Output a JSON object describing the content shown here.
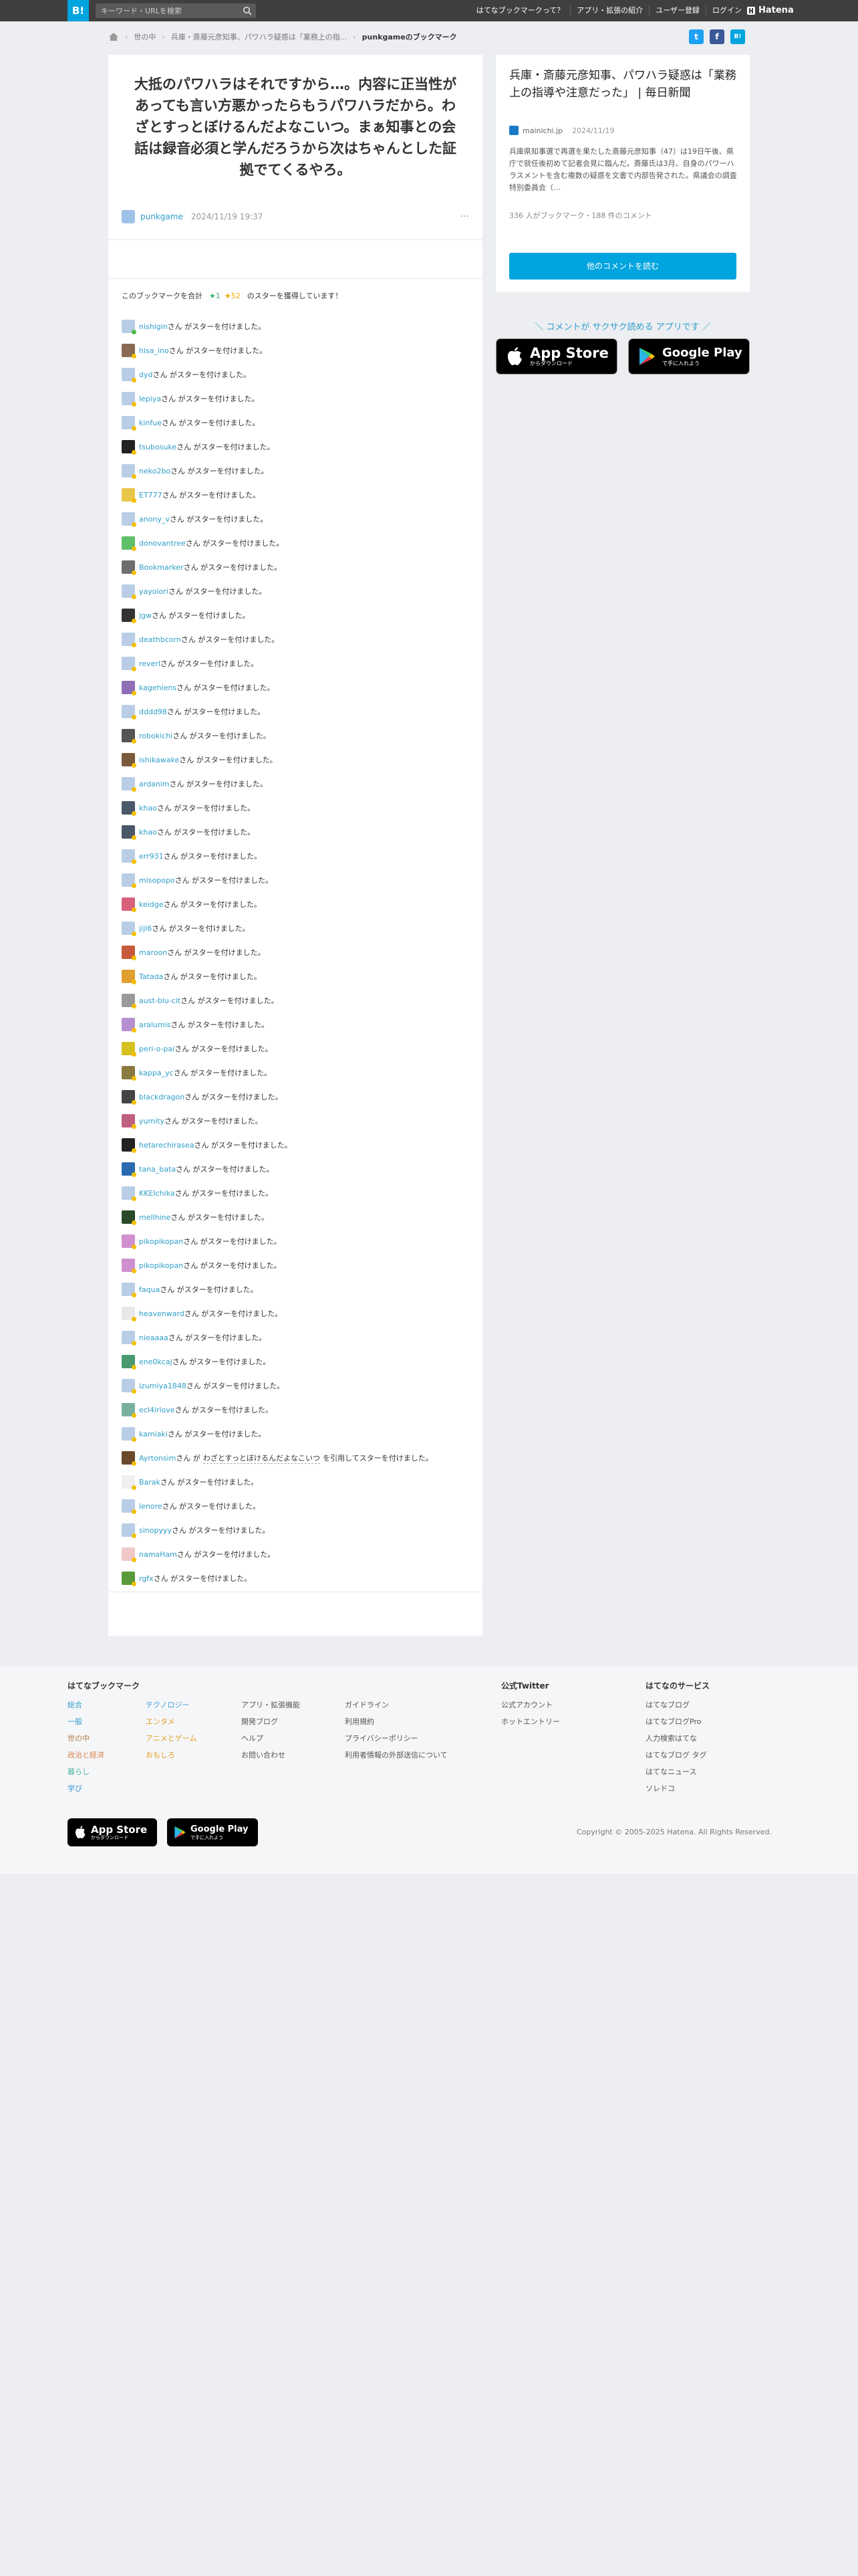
{
  "topbar": {
    "logo": "B!",
    "search_placeholder": "キーワード・URLを検索",
    "nav": [
      "はてなブックマークって？",
      "アプリ・拡張の紹介",
      "ユーザー登録",
      "ログイン"
    ],
    "brand": "Hatena"
  },
  "breadcrumb": {
    "items": [
      "世の中",
      "兵庫・斎藤元彦知事、パワハラ疑惑は「業務上の指...",
      "punkgameのブックマーク"
    ]
  },
  "share": [
    {
      "name": "twitter",
      "glyph": "t",
      "color": "#1da1f2"
    },
    {
      "name": "facebook",
      "glyph": "f",
      "color": "#3b5998"
    },
    {
      "name": "hatena",
      "glyph": "B!",
      "color": "#00a4de"
    }
  ],
  "comment": {
    "text": "大抵のパワハラはそれですから…。内容に正当性があっても言い方悪かったらもうパワハラだから。わざとすっとぼけるんだよなこいつ。まぁ知事との会話は録音必須と学んだろうから次はちゃんとした証拠でてくるやろ。",
    "user": "punkgame",
    "date": "2024/11/19 19:37",
    "more": "···"
  },
  "stars_summary": {
    "prefix": "このブックマークを合計",
    "green": "★1",
    "yellow": "★52",
    "suffix": "のスターを獲得しています！"
  },
  "star_suffix": "さん がスターを付けました。",
  "star_users": [
    {
      "user": "nishigin",
      "color": "#b9cde6"
    },
    {
      "user": "hisa_ino",
      "color": "#8a6a55"
    },
    {
      "user": "dyd",
      "color": "#b9cde6"
    },
    {
      "user": "lepiya",
      "color": "#b9cde6"
    },
    {
      "user": "kinfue",
      "color": "#b9cde6"
    },
    {
      "user": "tsubosuke",
      "color": "#222222"
    },
    {
      "user": "neko2bo",
      "color": "#b9cde6"
    },
    {
      "user": "ET777",
      "color": "#e8c64a"
    },
    {
      "user": "anony_v",
      "color": "#b9cde6"
    },
    {
      "user": "donovantree",
      "color": "#5fc06a"
    },
    {
      "user": "Bookmarker",
      "color": "#6e6e6e"
    },
    {
      "user": "yayoiori",
      "color": "#b9cde6"
    },
    {
      "user": "jgw",
      "color": "#333333"
    },
    {
      "user": "deathbcorn",
      "color": "#b9cde6"
    },
    {
      "user": "reverl",
      "color": "#b9cde6"
    },
    {
      "user": "kagehiens",
      "color": "#8e6fb5"
    },
    {
      "user": "dddd98",
      "color": "#b9cde6"
    },
    {
      "user": "robokichi",
      "color": "#555555"
    },
    {
      "user": "ishikawake",
      "color": "#7a5a3a"
    },
    {
      "user": "ardanim",
      "color": "#b9cde6"
    },
    {
      "user": "khao",
      "color": "#4a5868"
    },
    {
      "user": "khao",
      "color": "#4a5868"
    },
    {
      "user": "err931",
      "color": "#b9cde6"
    },
    {
      "user": "misopopo",
      "color": "#b9cde6"
    },
    {
      "user": "keidge",
      "color": "#d8607a"
    },
    {
      "user": "jiji6",
      "color": "#b9cde6"
    },
    {
      "user": "maroon",
      "color": "#c65a3a"
    },
    {
      "user": "Tatada",
      "color": "#e0a030"
    },
    {
      "user": "aust-blu-cit",
      "color": "#9a9a9a"
    },
    {
      "user": "aralumis",
      "color": "#b58fd0"
    },
    {
      "user": "peri-o-pai",
      "color": "#d6c020"
    },
    {
      "user": "kappa_yc",
      "color": "#8a7a40"
    },
    {
      "user": "blackdragon",
      "color": "#444444"
    },
    {
      "user": "yumity",
      "color": "#c06080"
    },
    {
      "user": "hetarechirasea",
      "color": "#222222"
    },
    {
      "user": "tana_bata",
      "color": "#2a6ab0"
    },
    {
      "user": "KKEIchika",
      "color": "#b9cde6"
    },
    {
      "user": "mellhine",
      "color": "#2a4a2a"
    },
    {
      "user": "pikopikopan",
      "color": "#d090d0"
    },
    {
      "user": "pikopikopan",
      "color": "#d090d0"
    },
    {
      "user": "faqua",
      "color": "#b9cde6"
    },
    {
      "user": "heavenward",
      "color": "#e8e8e8"
    },
    {
      "user": "nieaaaa",
      "color": "#b9cde6"
    },
    {
      "user": "ene0kcaj",
      "color": "#4a9a70"
    },
    {
      "user": "izumiya1848",
      "color": "#b9cde6"
    },
    {
      "user": "ecl4irlove",
      "color": "#7ab0a0"
    },
    {
      "user": "kamiaki",
      "color": "#b9cde6"
    },
    {
      "user": "Ayrtonsim",
      "color": "#6a4a2a",
      "quote": "わざとすっとぼけるんだよなこいつ",
      "suffix": "を引用してスターを付けました。"
    },
    {
      "user": "Barak",
      "color": "#f0f0f0"
    },
    {
      "user": "lenore",
      "color": "#b9cde6"
    },
    {
      "user": "sinopyyy",
      "color": "#b9cde6"
    },
    {
      "user": "namaHam",
      "color": "#f0c8c8"
    },
    {
      "user": "rgfx",
      "color": "#5a9a3a"
    }
  ],
  "entry": {
    "title": "兵庫・斎藤元彦知事、パワハラ疑惑は「業務上の指導や注意だった」 | 毎日新聞",
    "site": "mainichi.jp",
    "date": "2024/11/19",
    "description": "兵庫県知事選で再選を果たした斎藤元彦知事（47）は19日午後、県庁で就任後初めて記者会見に臨んだ。斎藤氏は3月、自身のパワーハラスメントを含む複数の疑惑を文書で内部告発された。県議会の調査特別委員会（…",
    "counts": "336 人がブックマーク・188 件のコメント",
    "button": "他のコメントを読む"
  },
  "app_promo": {
    "line": "＼ コメントが サクサク読める アプリです ／",
    "appstore": {
      "small": "からダウンロード",
      "big": "App Store"
    },
    "googleplay": {
      "small": "で手に入れよう",
      "big": "Google Play"
    }
  },
  "footer": {
    "col1_title": "はてなブックマーク",
    "categories_a": [
      {
        "label": "総合",
        "color": "#2f9ec9"
      },
      {
        "label": "一般",
        "color": "#2f9ec9"
      },
      {
        "label": "世の中",
        "color": "#b07a48"
      },
      {
        "label": "政治と経済",
        "color": "#d9874f"
      },
      {
        "label": "暮らし",
        "color": "#4ab3a0"
      },
      {
        "label": "学び",
        "color": "#3a9ad0"
      }
    ],
    "categories_b": [
      {
        "label": "テクノロジー",
        "color": "#4aa0d8"
      },
      {
        "label": "エンタメ",
        "color": "#e6a020"
      },
      {
        "label": "アニメとゲーム",
        "color": "#e6a020"
      },
      {
        "label": "おもしろ",
        "color": "#e6a020"
      }
    ],
    "links_a": [
      "アプリ・拡張機能",
      "開発ブログ",
      "ヘルプ",
      "お問い合わせ"
    ],
    "links_b": [
      "ガイドライン",
      "利用規約",
      "プライバシーポリシー",
      "利用者情報の外部送信について"
    ],
    "twitter_title": "公式Twitter",
    "twitter_links": [
      "公式アカウント",
      "ホットエントリー"
    ],
    "services_title": "はてなのサービス",
    "services": [
      "はてなブログ",
      "はてなブログPro",
      "人力検索はてな",
      "はてなブログ タグ",
      "はてなニュース",
      "ソレドコ"
    ],
    "appstore": {
      "small": "からダウンロード",
      "big": "App Store"
    },
    "googleplay": {
      "small": "で手に入れよう",
      "big": "Google Play"
    },
    "copyright": "Copyright © 2005-2025 Hatena. All Rights Reserved."
  }
}
